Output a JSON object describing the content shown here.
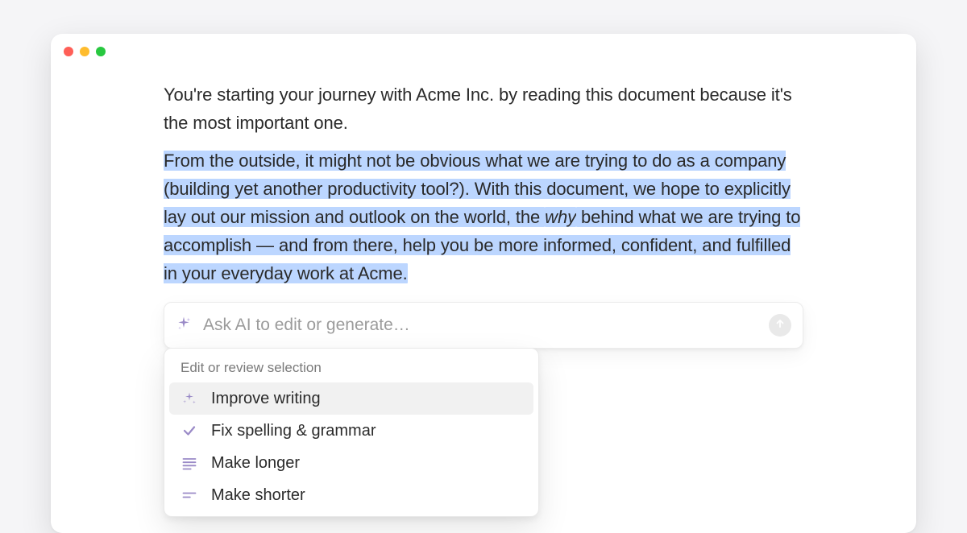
{
  "colors": {
    "accent_purple": "#9a8ac7",
    "selection_blue": "#bcd6ff"
  },
  "document": {
    "paragraph1": "You're starting your journey with Acme Inc. by reading this document because it's the most important one.",
    "paragraph2_part1": "From the outside, it might not be obvious what we are trying to do as a company (building yet another productivity tool?). With this document, we hope to explicitly lay out our mission and outlook on the world, the ",
    "paragraph2_italic": "why",
    "paragraph2_part2": " behind what we are trying to accomplish — and from there, help you be more informed, confident, and fulfilled in your everyday work at Acme."
  },
  "ai_bar": {
    "placeholder": "Ask AI to edit or generate…",
    "sparkle_icon": "sparkle-icon",
    "send_icon": "arrow-up-icon"
  },
  "menu": {
    "header": "Edit or review selection",
    "items": [
      {
        "icon": "magic-wand-icon",
        "label": "Improve writing",
        "hover": true
      },
      {
        "icon": "check-icon",
        "label": "Fix spelling & grammar",
        "hover": false
      },
      {
        "icon": "lines-long-icon",
        "label": "Make longer",
        "hover": false
      },
      {
        "icon": "lines-short-icon",
        "label": "Make shorter",
        "hover": false
      }
    ]
  }
}
